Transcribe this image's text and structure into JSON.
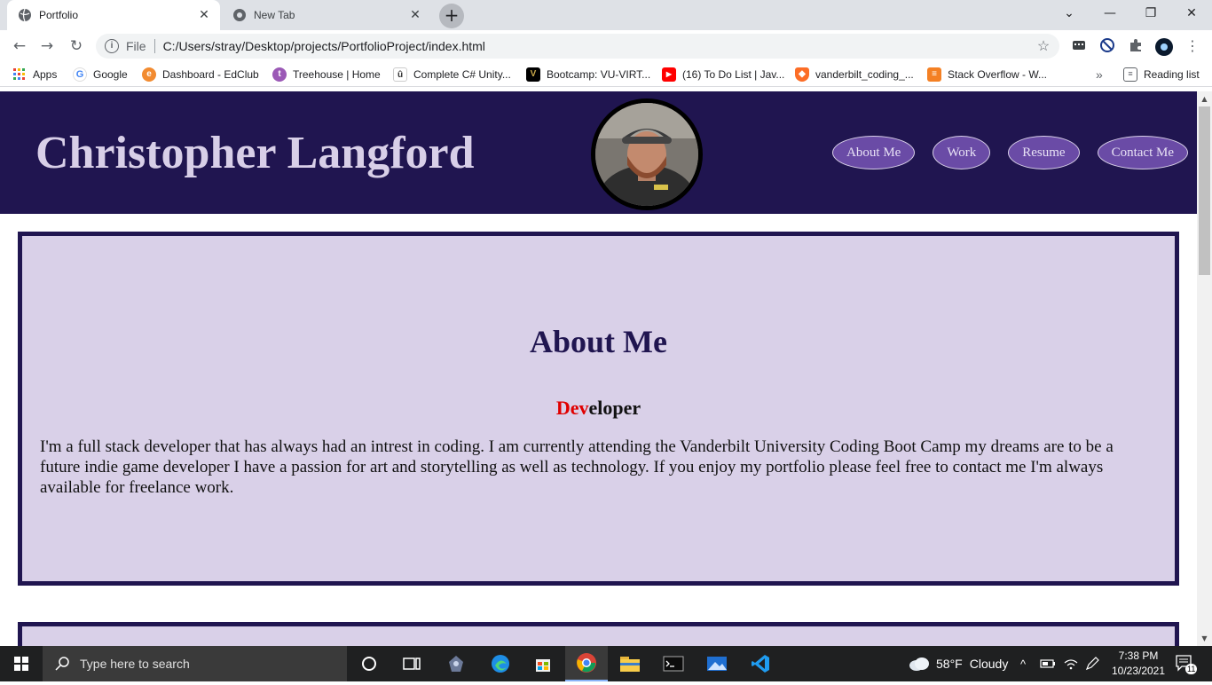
{
  "browser": {
    "tabs": [
      {
        "title": "Portfolio",
        "active": true
      },
      {
        "title": "New Tab",
        "active": false
      }
    ],
    "url_scheme": "File",
    "url": "C:/Users/stray/Desktop/projects/PortfolioProject/index.html",
    "bookmarks": [
      {
        "label": "Apps",
        "icon": "apps-grid-icon",
        "color": "#ea4335"
      },
      {
        "label": "Google",
        "icon": "google-icon",
        "color": "#4285f4"
      },
      {
        "label": "Dashboard - EdClub",
        "icon": "edclub-icon",
        "color": "#f28b30"
      },
      {
        "label": "Treehouse | Home",
        "icon": "treehouse-icon",
        "color": "#9b59b6"
      },
      {
        "label": "Complete C# Unity...",
        "icon": "udemy-icon",
        "color": "#ffffff"
      },
      {
        "label": "Bootcamp: VU-VIRT...",
        "icon": "vanderbilt-icon",
        "color": "#000000"
      },
      {
        "label": "(16) To Do List | Jav...",
        "icon": "youtube-icon",
        "color": "#ff0000"
      },
      {
        "label": "vanderbilt_coding_...",
        "icon": "gitlab-icon",
        "color": "#fc6d26"
      },
      {
        "label": "Stack Overflow - W...",
        "icon": "stackoverflow-icon",
        "color": "#f48024"
      }
    ],
    "reading_list": "Reading list",
    "overflow": "»"
  },
  "site": {
    "name": "Christopher Langford",
    "nav": [
      "About Me",
      "Work",
      "Resume",
      "Contact Me"
    ],
    "about": {
      "title": "About Me",
      "role_highlight": "Dev",
      "role_rest": "eloper",
      "bio": "I'm a full stack developer that has always had an intrest in coding. I am currently attending the Vanderbilt University Coding Boot Camp my dreams are to be a future indie game developer I have a passion for art and storytelling as well as technology. If you enjoy my portfolio please feel free to contact me I'm always available for freelance work."
    }
  },
  "taskbar": {
    "search_placeholder": "Type here to search",
    "weather_temp": "58°F",
    "weather_desc": "Cloudy",
    "time": "7:38 PM",
    "date": "10/23/2021",
    "notifications": "11"
  },
  "colors": {
    "header_bg": "#201550",
    "section_bg": "#d9d0e8",
    "nav_button": "#6a4ba6",
    "highlight": "#e00000"
  }
}
